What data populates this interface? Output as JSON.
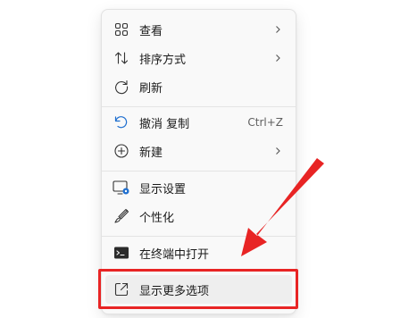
{
  "menu": {
    "items": [
      {
        "label": "查看",
        "icon": "grid-icon",
        "submenu": true
      },
      {
        "label": "排序方式",
        "icon": "sort-icon",
        "submenu": true
      },
      {
        "label": "刷新",
        "icon": "refresh-icon",
        "submenu": false
      },
      {
        "label": "撤消 复制",
        "icon": "undo-icon",
        "shortcut": "Ctrl+Z",
        "submenu": false
      },
      {
        "label": "新建",
        "icon": "add-circle-icon",
        "submenu": true
      },
      {
        "label": "显示设置",
        "icon": "display-settings-icon",
        "submenu": false
      },
      {
        "label": "个性化",
        "icon": "brush-icon",
        "submenu": false
      },
      {
        "label": "在终端中打开",
        "icon": "terminal-icon",
        "submenu": false
      },
      {
        "label": "显示更多选项",
        "icon": "show-more-icon",
        "submenu": false
      }
    ]
  },
  "annotation": {
    "color": "#e82424"
  }
}
